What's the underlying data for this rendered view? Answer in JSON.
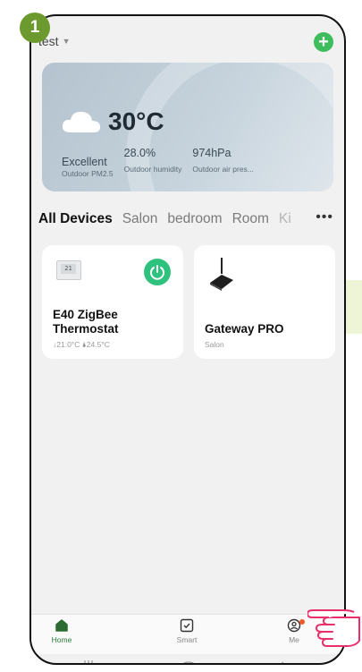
{
  "step_number": "1",
  "header": {
    "home_name": "test",
    "add_symbol": "+"
  },
  "weather": {
    "temperature": "30°C",
    "stats": [
      {
        "value": "Excellent",
        "label": "Outdoor PM2.5"
      },
      {
        "value": "28.0%",
        "label": "Outdoor humidity"
      },
      {
        "value": "974hPa",
        "label": "Outdoor air pres..."
      }
    ]
  },
  "room_tabs": [
    "All Devices",
    "Salon",
    "bedroom",
    "Room",
    "Ki"
  ],
  "more_symbol": "•••",
  "devices": [
    {
      "name": "E40 ZigBee Thermostat",
      "status": "↓21.0°C 🌢24.5°C",
      "icon": "thermostat-icon",
      "power_on": true
    },
    {
      "name": "Gateway PRO",
      "status": "Salon",
      "icon": "gateway-icon"
    }
  ],
  "bottom_tabs": [
    {
      "label": "Home",
      "icon": "home-icon",
      "active": true
    },
    {
      "label": "Smart",
      "icon": "smart-checkbox-icon",
      "active": false
    },
    {
      "label": "Me",
      "icon": "profile-icon",
      "active": false
    }
  ],
  "colors": {
    "accent_green": "#2ec27e",
    "badge_green": "#6d9a2e",
    "active_tab": "#2d7a3a",
    "notification_dot": "#f05a28"
  }
}
